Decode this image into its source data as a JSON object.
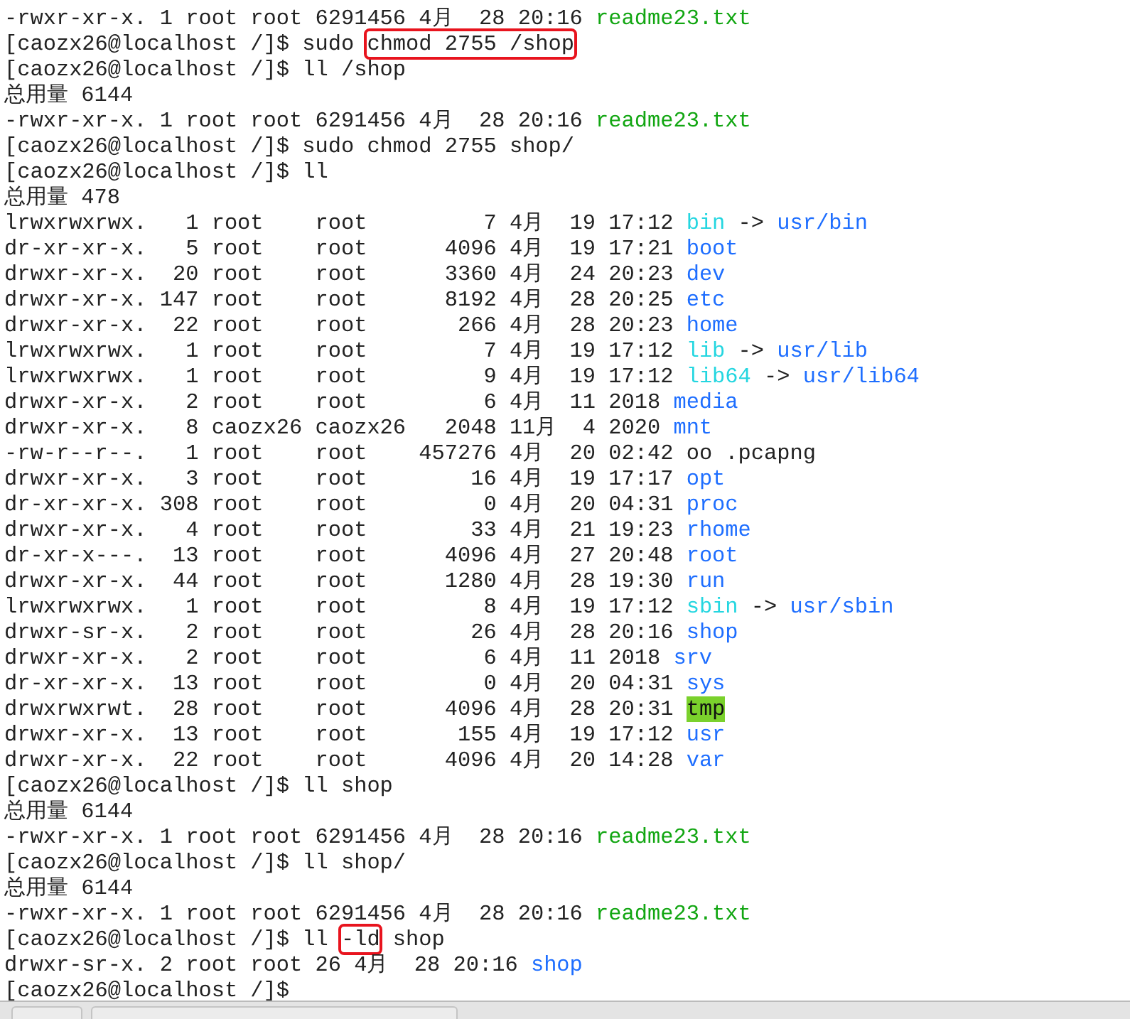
{
  "terminal": {
    "lines": [
      {
        "kind": "entry",
        "details": "-rwxr-xr-x. 1 root root 6291456 4月  28 20:16 ",
        "name": "readme23.txt",
        "color": "#12a612"
      },
      {
        "kind": "prompt",
        "prompt": "[caozx26@localhost /]$ ",
        "command": [
          {
            "text": "sudo ",
            "boxed": false
          },
          {
            "text": "chmod 2755 /shop",
            "boxed": true
          }
        ]
      },
      {
        "kind": "prompt",
        "prompt": "[caozx26@localhost /]$ ",
        "command": [
          {
            "text": "ll /shop",
            "boxed": false
          }
        ]
      },
      {
        "kind": "total",
        "text": "总用量 6144"
      },
      {
        "kind": "entry",
        "details": "-rwxr-xr-x. 1 root root 6291456 4月  28 20:16 ",
        "name": "readme23.txt",
        "color": "#12a612"
      },
      {
        "kind": "prompt",
        "prompt": "[caozx26@localhost /]$ ",
        "command": [
          {
            "text": "sudo chmod 2755 shop/",
            "boxed": false
          }
        ]
      },
      {
        "kind": "prompt",
        "prompt": "[caozx26@localhost /]$ ",
        "command": [
          {
            "text": "ll",
            "boxed": false
          }
        ]
      },
      {
        "kind": "total",
        "text": "总用量 478"
      },
      {
        "kind": "entry",
        "details": "lrwxrwxrwx.   1 root    root         7 4月  19 17:12 ",
        "name": "bin",
        "color": "#24d6e0",
        "arrow": "->",
        "target": "usr/bin"
      },
      {
        "kind": "entry",
        "details": "dr-xr-xr-x.   5 root    root      4096 4月  19 17:21 ",
        "name": "boot",
        "color": "#1e6eff"
      },
      {
        "kind": "entry",
        "details": "drwxr-xr-x.  20 root    root      3360 4月  24 20:23 ",
        "name": "dev",
        "color": "#1e6eff"
      },
      {
        "kind": "entry",
        "details": "drwxr-xr-x. 147 root    root      8192 4月  28 20:25 ",
        "name": "etc",
        "color": "#1e6eff"
      },
      {
        "kind": "entry",
        "details": "drwxr-xr-x.  22 root    root       266 4月  28 20:23 ",
        "name": "home",
        "color": "#1e6eff"
      },
      {
        "kind": "entry",
        "details": "lrwxrwxrwx.   1 root    root         7 4月  19 17:12 ",
        "name": "lib",
        "color": "#24d6e0",
        "arrow": "->",
        "target": "usr/lib"
      },
      {
        "kind": "entry",
        "details": "lrwxrwxrwx.   1 root    root         9 4月  19 17:12 ",
        "name": "lib64",
        "color": "#24d6e0",
        "arrow": "->",
        "target": "usr/lib64"
      },
      {
        "kind": "entry",
        "details": "drwxr-xr-x.   2 root    root         6 4月  11 2018 ",
        "name": "media",
        "color": "#1e6eff"
      },
      {
        "kind": "entry",
        "details": "drwxr-xr-x.   8 caozx26 caozx26   2048 11月  4 2020 ",
        "name": "mnt",
        "color": "#1e6eff"
      },
      {
        "kind": "entry",
        "details": "-rw-r--r--.   1 root    root    457276 4月  20 02:42 ",
        "name": "oo .pcapng",
        "color": "#222222"
      },
      {
        "kind": "entry",
        "details": "drwxr-xr-x.   3 root    root        16 4月  19 17:17 ",
        "name": "opt",
        "color": "#1e6eff"
      },
      {
        "kind": "entry",
        "details": "dr-xr-xr-x. 308 root    root         0 4月  20 04:31 ",
        "name": "proc",
        "color": "#1e6eff"
      },
      {
        "kind": "entry",
        "details": "drwxr-xr-x.   4 root    root        33 4月  21 19:23 ",
        "name": "rhome",
        "color": "#1e6eff"
      },
      {
        "kind": "entry",
        "details": "dr-xr-x---.  13 root    root      4096 4月  27 20:48 ",
        "name": "root",
        "color": "#1e6eff"
      },
      {
        "kind": "entry",
        "details": "drwxr-xr-x.  44 root    root      1280 4月  28 19:30 ",
        "name": "run",
        "color": "#1e6eff"
      },
      {
        "kind": "entry",
        "details": "lrwxrwxrwx.   1 root    root         8 4月  19 17:12 ",
        "name": "sbin",
        "color": "#24d6e0",
        "arrow": "->",
        "target": "usr/sbin"
      },
      {
        "kind": "entry",
        "details": "drwxr-sr-x.   2 root    root        26 4月  28 20:16 ",
        "name": "shop",
        "color": "#1e6eff"
      },
      {
        "kind": "entry",
        "details": "drwxr-xr-x.   2 root    root         6 4月  11 2018 ",
        "name": "srv",
        "color": "#1e6eff"
      },
      {
        "kind": "entry",
        "details": "dr-xr-xr-x.  13 root    root         0 4月  20 04:31 ",
        "name": "sys",
        "color": "#1e6eff"
      },
      {
        "kind": "entry",
        "details": "drwxrwxrwt.  28 root    root      4096 4月  28 20:31 ",
        "name": "tmp",
        "color": "#7ad12c",
        "highlighted": true
      },
      {
        "kind": "entry",
        "details": "drwxr-xr-x.  13 root    root       155 4月  19 17:12 ",
        "name": "usr",
        "color": "#1e6eff"
      },
      {
        "kind": "entry",
        "details": "drwxr-xr-x.  22 root    root      4096 4月  20 14:28 ",
        "name": "var",
        "color": "#1e6eff"
      },
      {
        "kind": "prompt",
        "prompt": "[caozx26@localhost /]$ ",
        "command": [
          {
            "text": "ll shop",
            "boxed": false
          }
        ]
      },
      {
        "kind": "total",
        "text": "总用量 6144"
      },
      {
        "kind": "entry",
        "details": "-rwxr-xr-x. 1 root root 6291456 4月  28 20:16 ",
        "name": "readme23.txt",
        "color": "#12a612"
      },
      {
        "kind": "prompt",
        "prompt": "[caozx26@localhost /]$ ",
        "command": [
          {
            "text": "ll shop/",
            "boxed": false
          }
        ]
      },
      {
        "kind": "total",
        "text": "总用量 6144"
      },
      {
        "kind": "entry",
        "details": "-rwxr-xr-x. 1 root root 6291456 4月  28 20:16 ",
        "name": "readme23.txt",
        "color": "#12a612"
      },
      {
        "kind": "prompt",
        "prompt": "[caozx26@localhost /]$ ",
        "command": [
          {
            "text": "ll ",
            "boxed": false
          },
          {
            "text": "-ld",
            "boxed": true
          },
          {
            "text": " shop",
            "boxed": false
          }
        ]
      },
      {
        "kind": "entry",
        "details": "drwxr-sr-x. 2 root root 26 4月  28 20:16 ",
        "name": "shop",
        "color": "#1e6eff"
      },
      {
        "kind": "prompt",
        "prompt": "[caozx26@localhost /]$ "
      }
    ]
  }
}
